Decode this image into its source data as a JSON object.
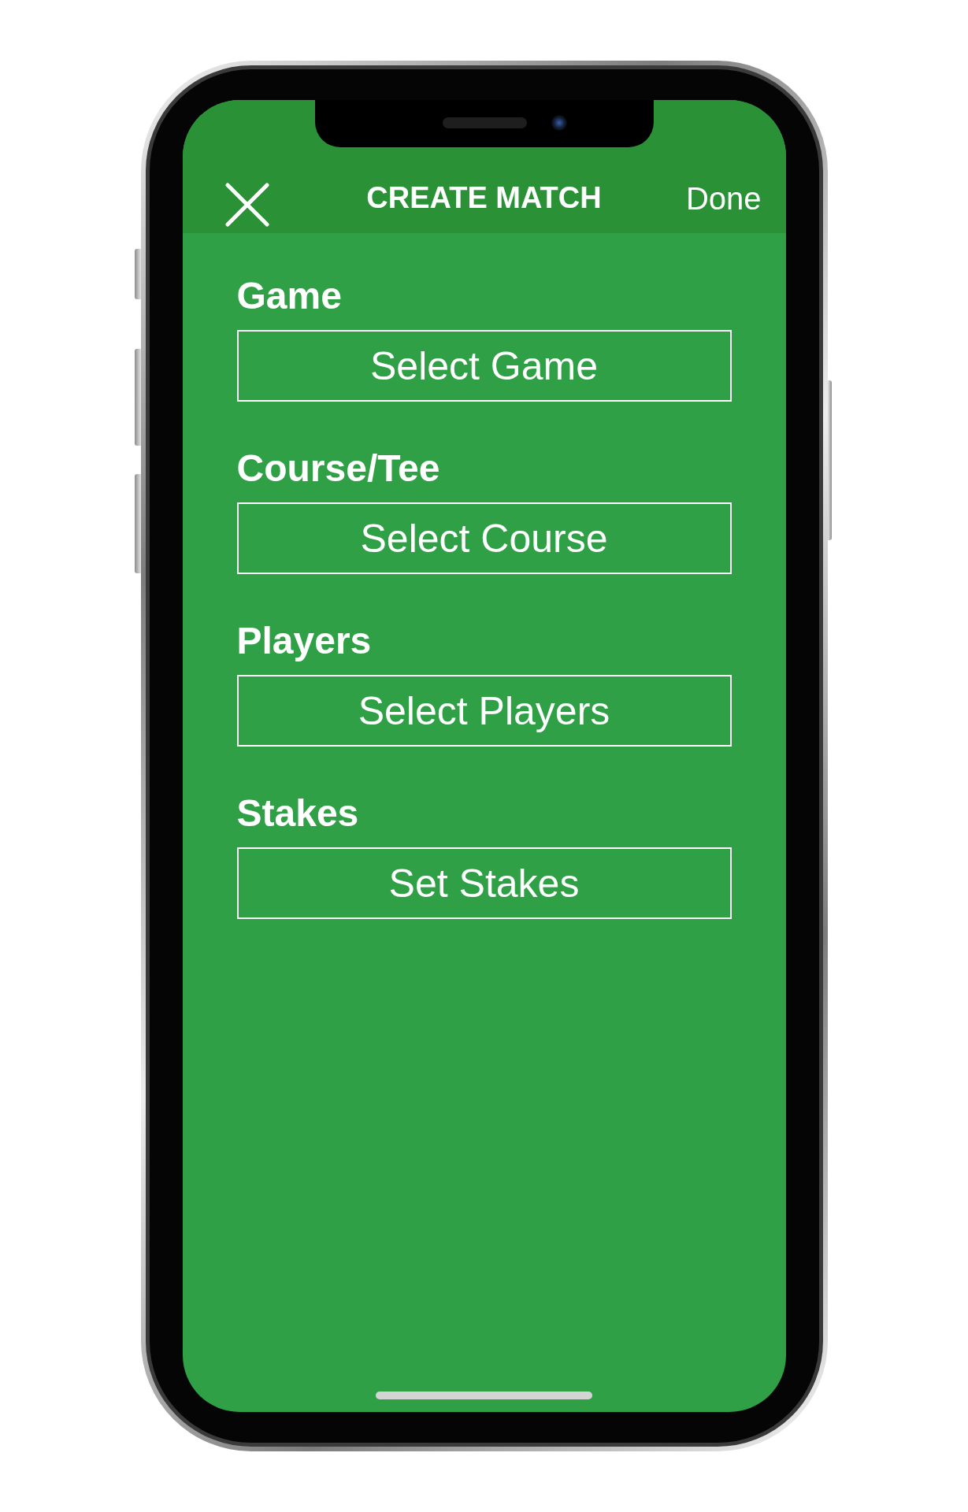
{
  "header": {
    "title": "CREATE MATCH",
    "action": "Done"
  },
  "sections": [
    {
      "label": "Game",
      "button": "Select Game"
    },
    {
      "label": "Course/Tee",
      "button": "Select Course"
    },
    {
      "label": "Players",
      "button": "Select Players"
    },
    {
      "label": "Stakes",
      "button": "Set Stakes"
    }
  ]
}
